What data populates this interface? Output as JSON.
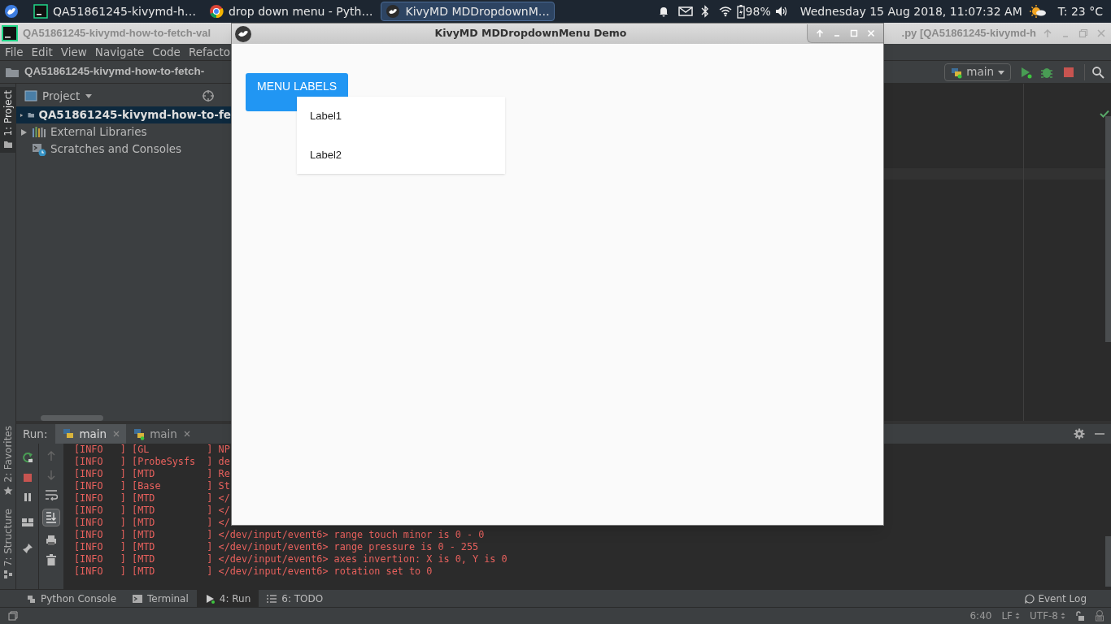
{
  "taskbar": {
    "tasks": [
      {
        "label": "QA51861245-kivymd-h…",
        "kind": "pycharm",
        "selected": false
      },
      {
        "label": "drop down menu - Pyth…",
        "kind": "chrome",
        "selected": false
      },
      {
        "label": "KivyMD MDDropdownM…",
        "kind": "kivy",
        "selected": true
      }
    ],
    "battery": "98%",
    "clock": "Wednesday 15 Aug 2018, 11:07:32 AM",
    "weather": "T: 23 °C"
  },
  "ide": {
    "title": "QA51861245-kivymd-how-to-fetch-val",
    "title_right": ".py [QA51861245-kivymd-h",
    "menu": [
      "File",
      "Edit",
      "View",
      "Navigate",
      "Code",
      "Refacto"
    ],
    "breadcrumb": "QA51861245-kivymd-how-to-fetch-",
    "run_config": "main",
    "side_tabs": [
      {
        "label": "1: Project",
        "selected": true
      },
      {
        "label": "2: Favorites",
        "selected": false
      },
      {
        "label": "7: Structure",
        "selected": false
      }
    ],
    "project": {
      "title": "Project",
      "tree": [
        {
          "label": "QA51861245-kivymd-how-to-fe",
          "kind": "folder",
          "selected": true
        },
        {
          "label": "External Libraries",
          "kind": "libraries",
          "selected": false
        },
        {
          "label": "Scratches and Consoles",
          "kind": "scratches",
          "selected": false
        }
      ]
    },
    "run": {
      "label": "Run:",
      "tabs": [
        {
          "label": "main",
          "selected": true
        },
        {
          "label": "main",
          "selected": false
        }
      ],
      "console": [
        "[INFO   ] [GL          ] NP",
        "[INFO   ] [ProbeSysfs  ] de",
        "[INFO   ] [MTD         ] Re",
        "[INFO   ] [Base        ] St",
        "[INFO   ] [MTD         ] </",
        "[INFO   ] [MTD         ] </",
        "[INFO   ] [MTD         ] </",
        "[INFO   ] [MTD         ] </dev/input/event6> range touch minor is 0 - 0",
        "[INFO   ] [MTD         ] </dev/input/event6> range pressure is 0 - 255",
        "[INFO   ] [MTD         ] </dev/input/event6> axes invertion: X is 0, Y is 0",
        "[INFO   ] [MTD         ] </dev/input/event6> rotation set to 0"
      ]
    },
    "tool_tabs": [
      {
        "label": "Python Console",
        "kind": "python",
        "selected": false
      },
      {
        "label": "Terminal",
        "kind": "terminal",
        "selected": false
      },
      {
        "label": "4: Run",
        "kind": "run",
        "selected": true
      },
      {
        "label": "6: TODO",
        "kind": "todo",
        "selected": false
      }
    ],
    "event_log": "Event Log",
    "status": [
      "6:40",
      "LF",
      "UTF-8"
    ]
  },
  "kivy_window": {
    "title": "KivyMD MDDropdownMenu Demo",
    "button": "MENU LABELS",
    "menu_items": [
      "Label1",
      "Label2"
    ]
  }
}
